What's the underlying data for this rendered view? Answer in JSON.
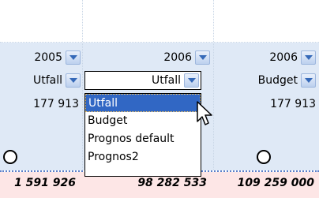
{
  "header_row": {
    "col1": {
      "year": "2005"
    },
    "col2": {
      "year": "2006"
    },
    "col3": {
      "year": "2006"
    }
  },
  "type_row": {
    "col1": {
      "type": "Utfall"
    },
    "col2": {
      "type": "Utfall"
    },
    "col3": {
      "type": "Budget"
    }
  },
  "value_row": {
    "col1": "177 913",
    "col3": "177 913"
  },
  "dropdown_options": [
    "Utfall",
    "Budget",
    "Prognos default",
    "Prognos2"
  ],
  "selected_option": "Utfall",
  "totals": [
    "1 591 926",
    "98 282 533",
    "109 259 000"
  ],
  "colors": {
    "grid_bg": "#dfe9f6",
    "dropdown_btn": "#3569b8",
    "highlight": "#3167c4",
    "totals_bg": "#fde6e6"
  }
}
